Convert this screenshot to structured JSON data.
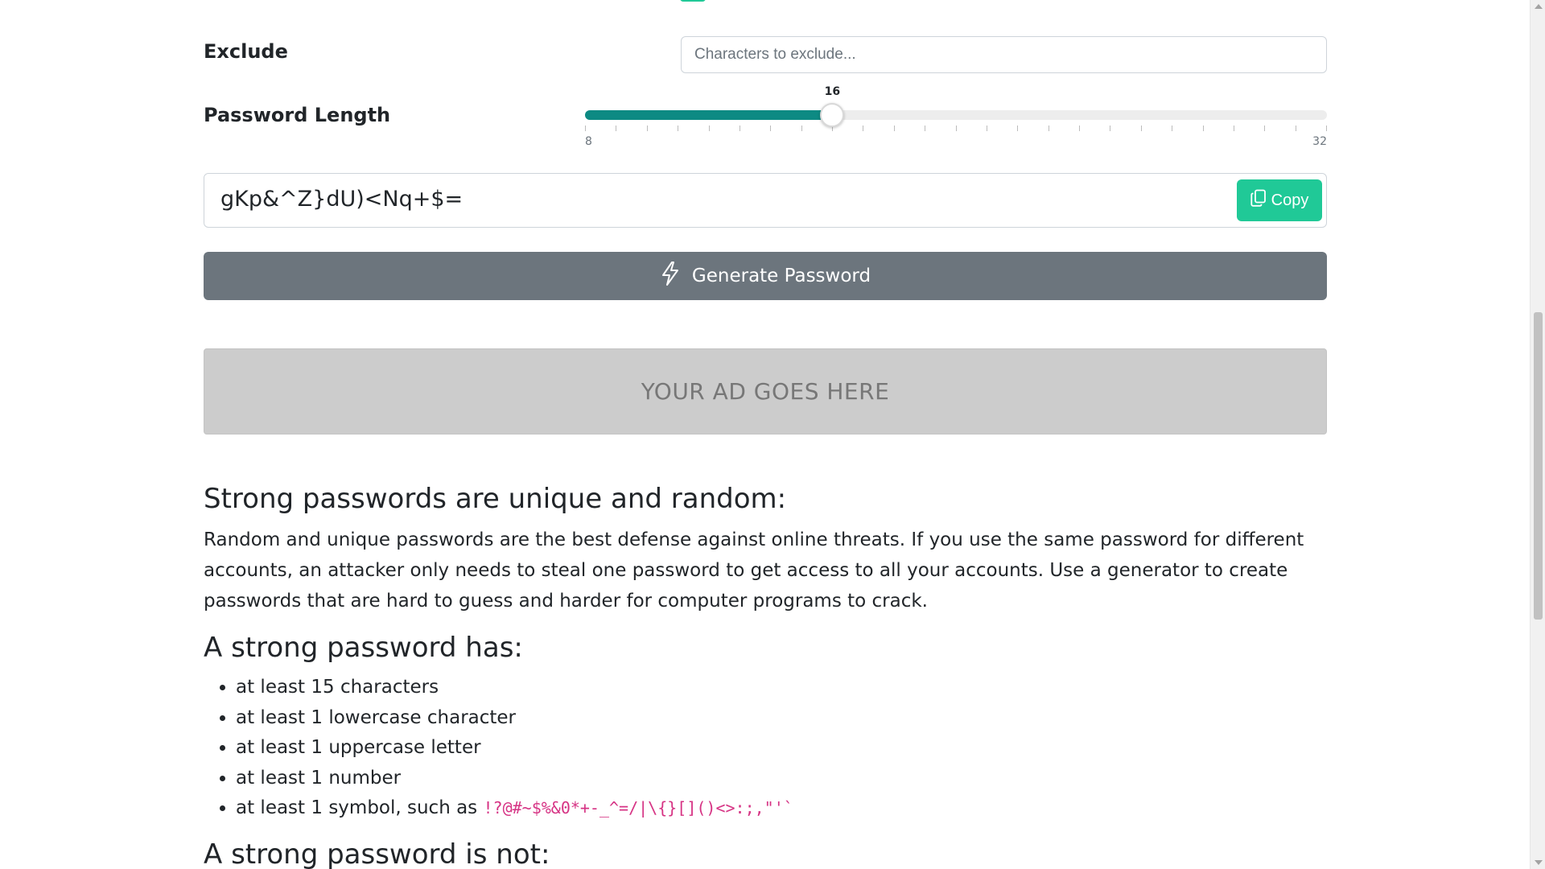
{
  "exclude": {
    "label": "Exclude",
    "value": "",
    "placeholder": "Characters to exclude..."
  },
  "length": {
    "label": "Password Length",
    "value": 16,
    "min": 8,
    "max": 32
  },
  "password": {
    "value": "gKp&^Z}dU)<Nq+$=",
    "copy_label": "Copy"
  },
  "generate": {
    "label": "Generate Password"
  },
  "ad": {
    "text": "YOUR AD GOES HERE"
  },
  "article": {
    "heading_unique": "Strong passwords are unique and random:",
    "paragraph_unique": "Random and unique passwords are the best defense against online threats. If you use the same password for different accounts, an attacker only needs to steal one password to get access to all your accounts. Use a generator to create passwords that are hard to guess and harder for computer programs to crack.",
    "heading_has": "A strong password has:",
    "requirements": [
      "at least 15 characters",
      "at least 1 lowercase character",
      "at least 1 uppercase letter",
      "at least 1 number",
      "at least 1 symbol, such as "
    ],
    "symbols": "!?@#~$%&0*+-_^=/|\\{}[]()<>:;,\"'`",
    "heading_not": "A strong password is not:"
  },
  "icons": {
    "copy": "copy-icon",
    "generate": "lightning-icon"
  },
  "colors": {
    "accent": "#20c997",
    "slider_fill": "#0d8a83",
    "generate_button": "#6c757d",
    "ad_background": "#cccccc",
    "code": "#d63384"
  }
}
